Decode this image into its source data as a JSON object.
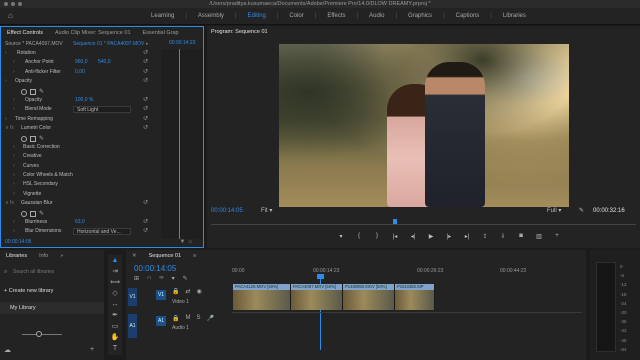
{
  "window": {
    "title": "/Users/praditya.kusumaeca/Documents/Adobe/Premiere Pro/14.0/DLOW DREAMY.prproj *"
  },
  "workspace": {
    "tabs": [
      "Learning",
      "Assembly",
      "Editing",
      "Color",
      "Effects",
      "Audio",
      "Graphics",
      "Captions",
      "Libraries"
    ],
    "active": "Editing"
  },
  "effect_controls": {
    "tabs": [
      "Effect Controls",
      "Audio Clip Mixer: Sequence 01",
      "Essential Grap"
    ],
    "source": "Source * PACA4097.MOV",
    "sequence": "Sequence 01 * PACA4097.MOV",
    "timecode": "00:00:14:23",
    "footer_timecode": "00:00:14:05",
    "rows": [
      {
        "indent": 0,
        "type": "prop",
        "label": "Rotation",
        "value": ""
      },
      {
        "indent": 1,
        "type": "prop",
        "label": "Anchor Point",
        "value": "960,0",
        "value2": "540,0"
      },
      {
        "indent": 1,
        "type": "prop",
        "label": "Anti-flicker Filter",
        "value": "0,00"
      },
      {
        "indent": 0,
        "type": "section",
        "label": "Opacity"
      },
      {
        "indent": 1,
        "type": "shapes"
      },
      {
        "indent": 1,
        "type": "prop",
        "label": "Opacity",
        "value": "100,0 %"
      },
      {
        "indent": 1,
        "type": "select",
        "label": "Blend Mode",
        "value": "Soft Light"
      },
      {
        "indent": 0,
        "type": "section",
        "label": "Time Remapping"
      },
      {
        "indent": 0,
        "type": "fx",
        "label": "Lumetri Color"
      },
      {
        "indent": 1,
        "type": "shapes"
      },
      {
        "indent": 1,
        "type": "plain",
        "label": "Basic Correction"
      },
      {
        "indent": 1,
        "type": "plain",
        "label": "Creative"
      },
      {
        "indent": 1,
        "type": "plain",
        "label": "Curves"
      },
      {
        "indent": 1,
        "type": "plain",
        "label": "Color Wheels & Match"
      },
      {
        "indent": 1,
        "type": "plain",
        "label": "HSL Secondary"
      },
      {
        "indent": 1,
        "type": "plain",
        "label": "Vignette"
      },
      {
        "indent": 0,
        "type": "fx",
        "label": "Gaussian Blur"
      },
      {
        "indent": 1,
        "type": "shapes"
      },
      {
        "indent": 1,
        "type": "prop",
        "label": "Blurriness",
        "value": "63,0"
      },
      {
        "indent": 1,
        "type": "select",
        "label": "Blur Dimensions",
        "value": "Horizontal and Ve..."
      }
    ]
  },
  "program": {
    "label": "Program: Sequence 01",
    "timecode": "00:00:14:05",
    "fit": "Fit",
    "quality": "Full",
    "duration": "00:00:32:16"
  },
  "libraries": {
    "tabs": [
      "Libraries",
      "Info"
    ],
    "search_placeholder": "Search all libraries",
    "create_label": "+ Create new library",
    "my_library": "My Library"
  },
  "timeline": {
    "tab": "Sequence 01",
    "timecode": "00:00:14:05",
    "ruler": [
      "00:00",
      "00:00:14:23",
      "00:00:29:23",
      "00:00:44:22"
    ],
    "video_track": {
      "target": "V1",
      "name": "Video 1"
    },
    "audio_track": {
      "target": "A1",
      "name": "Audio 1"
    },
    "clips": [
      "PACA4126.MOV [50%]",
      "PACA4097.MOV [50%]",
      "P1480990.MOV [50%]",
      "P1510382.MP"
    ]
  },
  "meters": {
    "scale": [
      "0",
      "-6",
      "-12",
      "-18",
      "-24",
      "-30",
      "-36",
      "-42",
      "-48",
      "-54"
    ]
  },
  "colors": {
    "accent": "#2d8ceb",
    "panel": "#232323",
    "bg": "#1b1b1b"
  }
}
